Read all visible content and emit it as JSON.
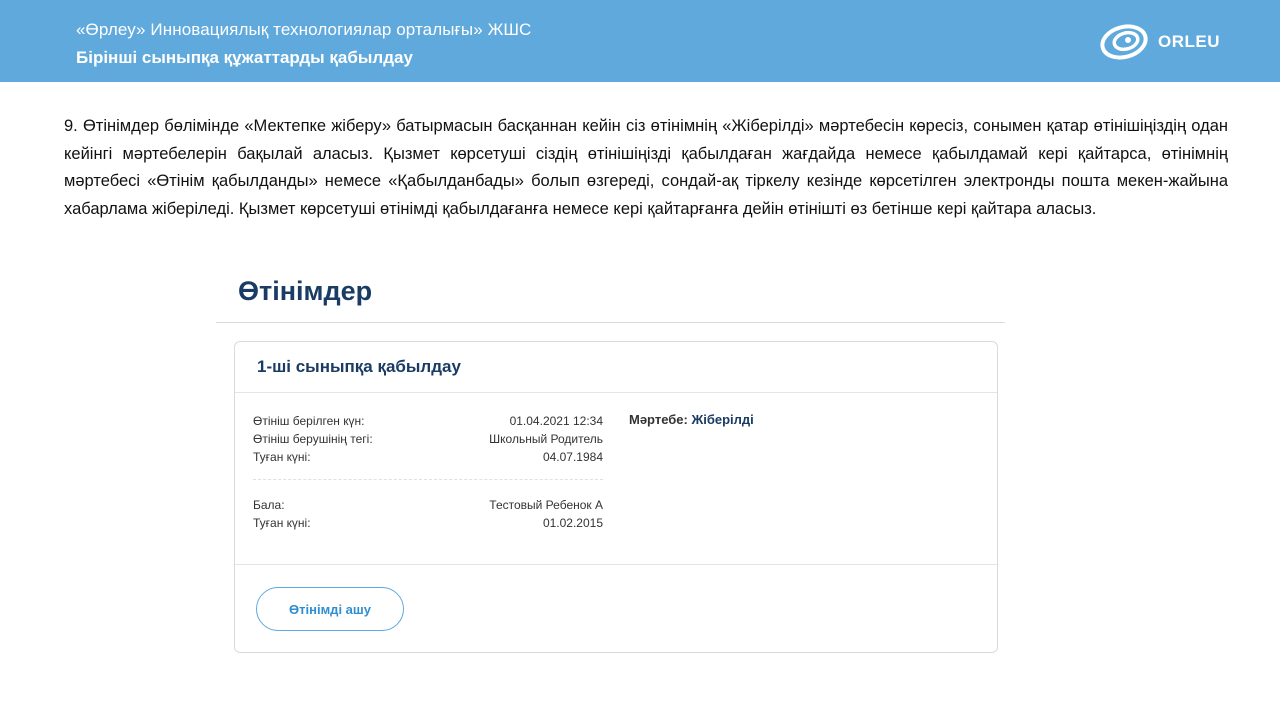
{
  "header": {
    "org_name": "«Өрлеу» Инновациялық технологиялар орталығы» ЖШС",
    "slide_title": "Бірінші сыныпқа құжаттарды қабылдау",
    "logo_text": "ORLEU"
  },
  "paragraph": "9. Өтінімдер бөлімінде «Мектепке жіберу» батырмасын басқаннан кейін сіз өтінімнің «Жіберілді» мәртебесін көресіз, сонымен қатар өтінішіңіздің одан кейінгі мәртебелерін бақылай аласыз. Қызмет көрсетуші сіздің өтінішіңізді қабылдаған жағдайда немесе қабылдамай кері қайтарса, өтінімнің мәртебесі «Өтінім қабылданды» немесе «Қабылданбады» болып өзгереді, сондай-ақ тіркелу кезінде көрсетілген электронды пошта мекен-жайына хабарлама жіберіледі. Қызмет көрсетуші өтінімді қабылдағанға немесе кері қайтарғанға дейін өтінішті өз бетінше кері қайтара аласыз.",
  "page_heading": "Өтінімдер",
  "card": {
    "title": "1-ші сыныпқа қабылдау",
    "applicant": [
      {
        "label": "Өтініш берілген күн:",
        "value": "01.04.2021 12:34"
      },
      {
        "label": "Өтініш берушінің тегі:",
        "value": "Школьный Родитель"
      },
      {
        "label": "Туған күні:",
        "value": "04.07.1984"
      }
    ],
    "child": [
      {
        "label": "Бала:",
        "value": "Тестовый Ребенок А"
      },
      {
        "label": "Туған күні:",
        "value": "01.02.2015"
      }
    ],
    "status_label": "Мәртебе:",
    "status_value": "Жіберілді",
    "open_button": "Өтінімді ашу"
  },
  "colors": {
    "header_bg": "#5fa9dd",
    "heading_navy": "#1a3b63",
    "button_accent": "#2f8ed1"
  }
}
